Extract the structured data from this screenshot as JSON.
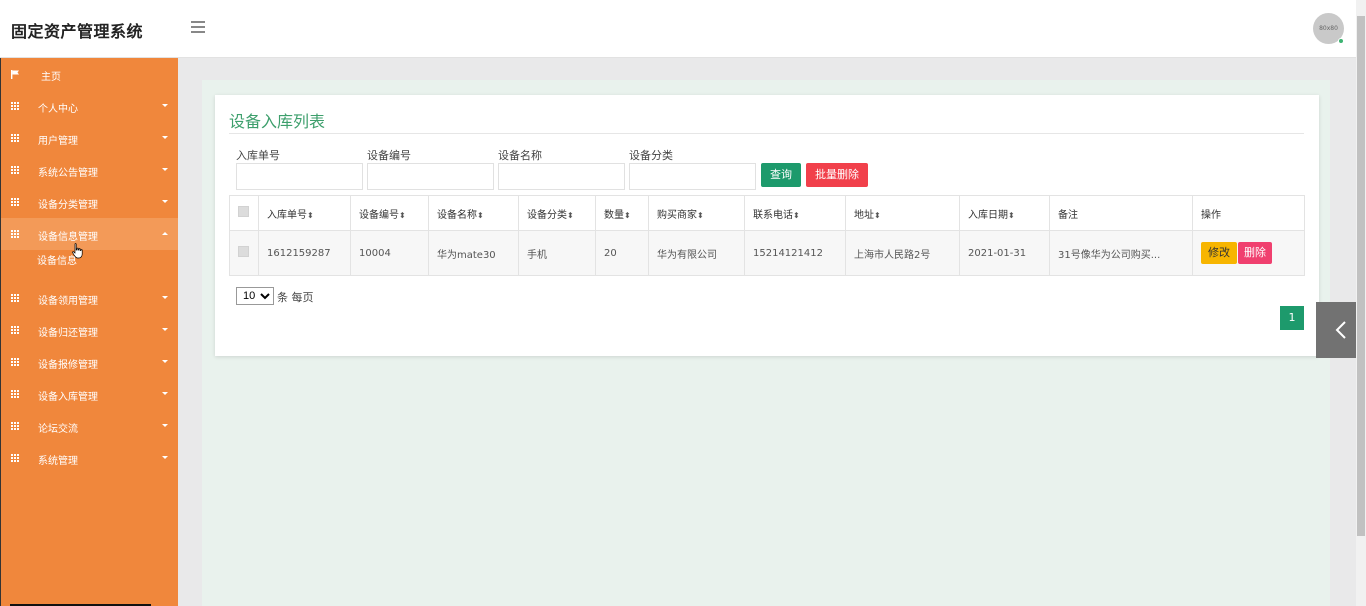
{
  "header": {
    "app_title": "固定资产管理系统",
    "avatar_text": "80x80"
  },
  "sidebar": {
    "items": [
      {
        "label": "主页",
        "icon": "flag-icon"
      },
      {
        "label": "个人中心",
        "icon": "grid-icon"
      },
      {
        "label": "用户管理",
        "icon": "grid-icon"
      },
      {
        "label": "系统公告管理",
        "icon": "grid-icon"
      },
      {
        "label": "设备分类管理",
        "icon": "grid-icon"
      },
      {
        "label": "设备信息管理",
        "icon": "grid-icon",
        "expanded": true
      },
      {
        "label": "设备领用管理",
        "icon": "grid-icon"
      },
      {
        "label": "设备归还管理",
        "icon": "grid-icon"
      },
      {
        "label": "设备报修管理",
        "icon": "grid-icon"
      },
      {
        "label": "设备入库管理",
        "icon": "grid-icon"
      },
      {
        "label": "论坛交流",
        "icon": "grid-icon"
      },
      {
        "label": "系统管理",
        "icon": "grid-icon"
      }
    ],
    "sub_item": "设备信息"
  },
  "main": {
    "title": "设备入库列表",
    "filters": {
      "receipt_no_label": "入库单号",
      "device_no_label": "设备编号",
      "device_name_label": "设备名称",
      "device_category_label": "设备分类"
    },
    "buttons": {
      "query": "查询",
      "batch_delete": "批量删除"
    },
    "table": {
      "headers": [
        "入库单号",
        "设备编号",
        "设备名称",
        "设备分类",
        "数量",
        "购买商家",
        "联系电话",
        "地址",
        "入库日期",
        "备注",
        "操作"
      ],
      "sort_glyph": "⬍",
      "rows": [
        {
          "receipt_no": "1612159287",
          "device_no": "10004",
          "device_name": "华为mate30",
          "category": "手机",
          "quantity": "20",
          "vendor": "华为有限公司",
          "phone": "15214121412",
          "address": "上海市人民路2号",
          "date": "2021-01-31",
          "remark": "31号像华为公司购买...",
          "edit": "修改",
          "delete": "删除"
        }
      ]
    },
    "pagination": {
      "page_size": "10",
      "page_size_unit": "条 每页",
      "current_page": "1"
    }
  },
  "colors": {
    "sidebar": "#f0873c",
    "accent_green": "#1d9a6c",
    "title_green": "#3d9f6c",
    "danger": "#f1404b",
    "warning": "#f7b500"
  }
}
